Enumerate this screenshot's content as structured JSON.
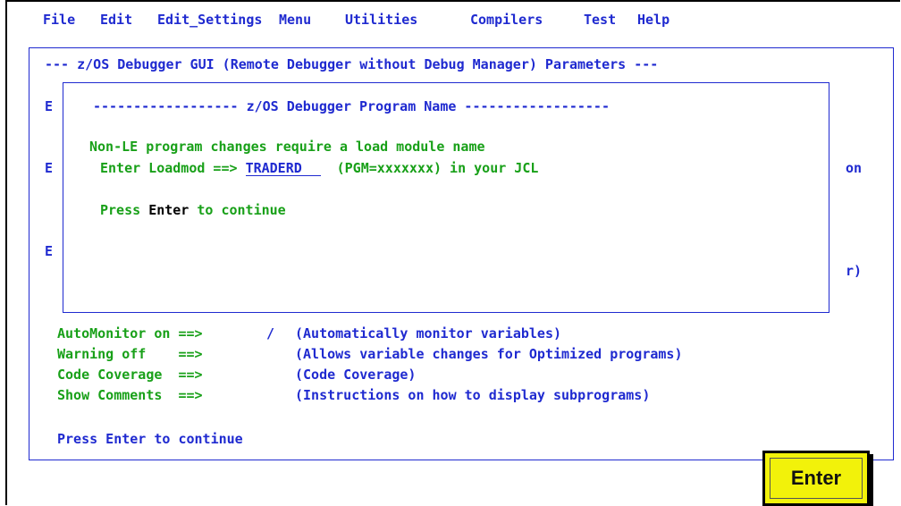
{
  "menu": [
    "File",
    "Edit",
    "Edit_Settings",
    "Menu",
    "Utilities",
    "Compilers",
    "Test",
    "Help"
  ],
  "panel_title": "--- z/OS Debugger GUI (Remote Debugger without Debug Manager) Parameters ---",
  "left_letters": [
    "E",
    "E",
    "E"
  ],
  "right_fragments": [
    "on",
    "r)"
  ],
  "popup": {
    "title": "------------------ z/OS Debugger Program Name ------------------",
    "line1": "Non-LE program changes require a load module name",
    "loadmod_prefix": "Enter Loadmod ==> ",
    "loadmod_value": "TRADERD",
    "loadmod_suffix": "  (PGM=xxxxxxx) in your JCL",
    "press_prefix": "Press ",
    "press_key": "Enter",
    "press_suffix": " to continue"
  },
  "options": [
    {
      "label": "AutoMonitor on ==>",
      "value": "/",
      "desc": "(Automatically monitor variables)"
    },
    {
      "label": "Warning off    ==>",
      "value": "",
      "desc": "(Allows variable changes for Optimized programs)"
    },
    {
      "label": "Code Coverage  ==>",
      "value": "",
      "desc": "(Code Coverage)"
    },
    {
      "label": "Show Comments  ==>",
      "value": "",
      "desc": "(Instructions on how to display subprograms)"
    }
  ],
  "footer_text": "Press Enter to continue",
  "enter_button_label": "Enter",
  "colors": {
    "blue": "#1f2ad0",
    "green": "#18a018",
    "button_yellow": "#f2f20a"
  }
}
